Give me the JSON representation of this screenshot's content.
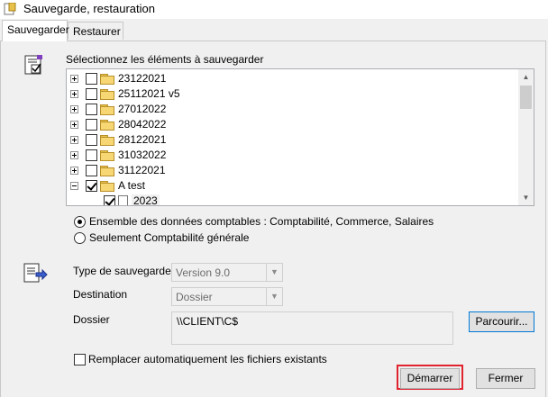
{
  "window": {
    "title": "Sauvegarde, restauration"
  },
  "tabs": [
    {
      "label": "Sauvegarder",
      "active": true
    },
    {
      "label": "Restaurer",
      "active": false
    }
  ],
  "select_label": "Sélectionnez les éléments à sauvegarder",
  "tree": {
    "items": [
      {
        "label": "23122021",
        "checked": false,
        "expanded": false
      },
      {
        "label": "25112021 v5",
        "checked": false,
        "expanded": false
      },
      {
        "label": "27012022",
        "checked": false,
        "expanded": false
      },
      {
        "label": "28042022",
        "checked": false,
        "expanded": false
      },
      {
        "label": "28122021",
        "checked": false,
        "expanded": false
      },
      {
        "label": "31032022",
        "checked": false,
        "expanded": false
      },
      {
        "label": "31122021",
        "checked": false,
        "expanded": false
      },
      {
        "label": "A test",
        "checked": true,
        "expanded": true
      },
      {
        "label": "2023",
        "checked": true,
        "child": true
      }
    ]
  },
  "radios": [
    {
      "label": "Ensemble des données comptables : Comptabilité, Commerce, Salaires",
      "selected": true
    },
    {
      "label": "Seulement Comptabilité générale",
      "selected": false
    }
  ],
  "form": {
    "type_label": "Type de sauvegarde",
    "type_value": "Version 9.0",
    "destination_label": "Destination",
    "destination_value": "Dossier",
    "dossier_label": "Dossier",
    "dossier_value": "\\\\CLIENT\\C$",
    "browse_label": "Parcourir..."
  },
  "replace_label": "Remplacer automatiquement les fichiers existants",
  "replace_checked": false,
  "buttons": {
    "start": "Démarrer",
    "close": "Fermer"
  },
  "colors": {
    "highlight": "#e0242f",
    "folder": "#f7d674"
  }
}
